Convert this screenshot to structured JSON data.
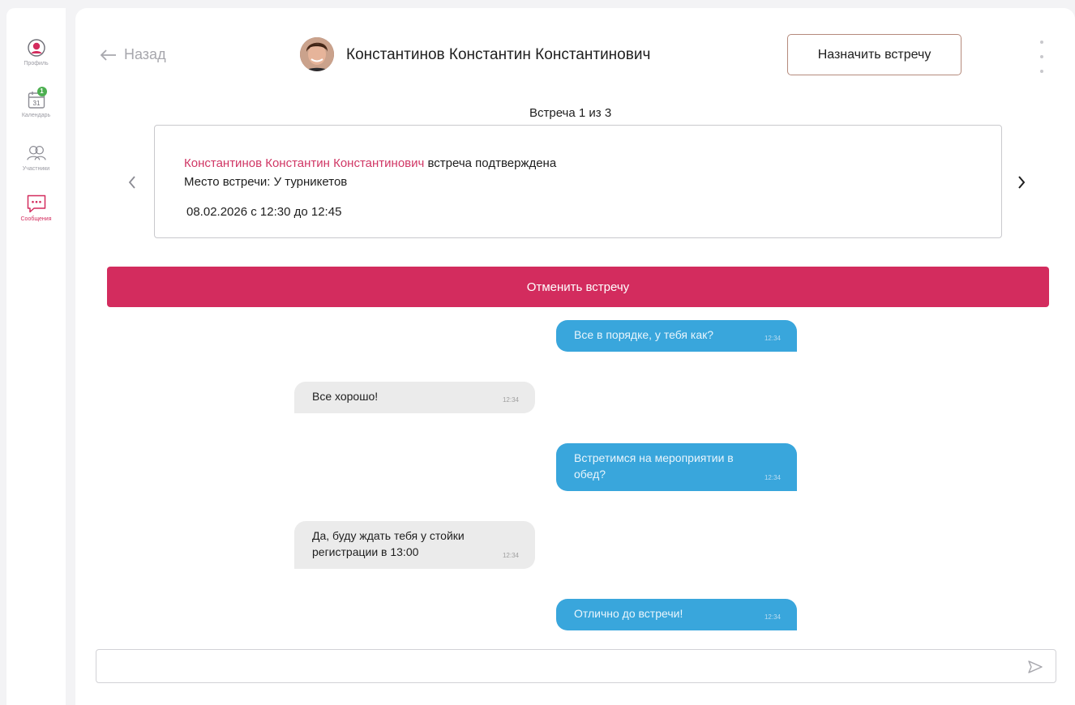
{
  "sidebar": {
    "items": [
      {
        "label": "Профиль",
        "icon": "profile-icon",
        "active": false
      },
      {
        "label": "Календарь",
        "icon": "calendar-icon",
        "active": false,
        "calendar_day": "31",
        "badge": "1"
      },
      {
        "label": "Участники",
        "icon": "participants-icon",
        "active": false
      },
      {
        "label": "Сообщения",
        "icon": "messages-icon",
        "active": true
      }
    ]
  },
  "header": {
    "back_label": "Назад",
    "contact_name": "Константинов Константин Константинович",
    "schedule_button": "Назначить встречу"
  },
  "meeting": {
    "counter": "Встреча 1 из 3",
    "person": "Константинов Константин Константинович",
    "status": "встреча подтверждена",
    "place": "Место встречи: У турникетов",
    "datetime": "08.02.2026 с 12:30 до 12:45",
    "cancel_button": "Отменить встречу"
  },
  "messages": [
    {
      "direction": "out",
      "text": "Все в порядке, у тебя как?",
      "time": "12:34"
    },
    {
      "direction": "in",
      "text": "Все хорошо!",
      "time": "12:34"
    },
    {
      "direction": "out",
      "text": "Встретимся на мероприятии в обед?",
      "time": "12:34"
    },
    {
      "direction": "in",
      "text": "Да, буду ждать тебя у стойки регистрации в 13:00",
      "time": "12:34"
    },
    {
      "direction": "out",
      "text": "Отлично до встречи!",
      "time": "12:34"
    }
  ],
  "composer": {
    "value": "",
    "placeholder": ""
  },
  "colors": {
    "accent": "#d32c5e",
    "outgoing_bubble": "#39a6dc",
    "incoming_bubble": "#ebebeb",
    "badge": "#4caf50"
  }
}
